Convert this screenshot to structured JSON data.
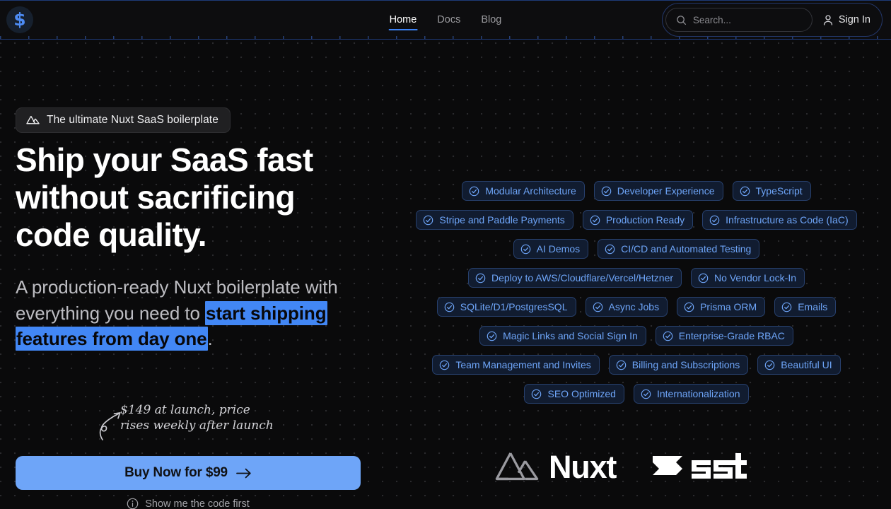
{
  "header": {
    "logo_icon": "dollar-sign-logo",
    "nav": [
      {
        "label": "Home",
        "active": true
      },
      {
        "label": "Docs",
        "active": false
      },
      {
        "label": "Blog",
        "active": false
      }
    ],
    "search": {
      "placeholder": "Search...",
      "value": "",
      "icon": "search-icon"
    },
    "sign_in": {
      "label": "Sign In",
      "icon": "user-icon"
    }
  },
  "hero": {
    "badge": {
      "icon": "nuxt-mountain-icon",
      "label": "The ultimate Nuxt SaaS boilerplate"
    },
    "headline": "Ship your SaaS fast without sacrificing code quality.",
    "subcopy_before": "A production-ready Nuxt boilerplate with everything you need to ",
    "subcopy_highlight": "start shipping features from day one",
    "subcopy_after": ".",
    "note": "$149 at launch, price\nrises weekly after launch",
    "cta": {
      "label": "Buy Now for $99",
      "icon": "arrow-right-icon"
    },
    "secondary": {
      "label": "Show me the code first",
      "icon": "info-icon"
    }
  },
  "features": {
    "check_icon": "check-circle-icon",
    "rows": [
      [
        "Modular Architecture",
        "Developer Experience",
        "TypeScript"
      ],
      [
        "Stripe and Paddle Payments",
        "Production Ready",
        "Infrastructure as Code (IaC)"
      ],
      [
        "AI Demos",
        "CI/CD and Automated Testing"
      ],
      [
        "Deploy to AWS/Cloudflare/Vercel/Hetzner",
        "No Vendor Lock-In"
      ],
      [
        "SQLite/D1/PostgresSQL",
        "Async Jobs",
        "Prisma ORM",
        "Emails"
      ],
      [
        "Magic Links and Social Sign In",
        "Enterprise-Grade RBAC"
      ],
      [
        "Team Management and Invites",
        "Billing and Subscriptions",
        "Beautiful UI"
      ],
      [
        "SEO Optimized",
        "Internationalization"
      ]
    ]
  },
  "brand_logos": [
    {
      "name": "nuxt-logo",
      "label": "Nuxt"
    },
    {
      "name": "sst-logo",
      "label": "sst"
    }
  ],
  "colors": {
    "accent_blue": "#4287f5",
    "cta_blue": "#6ea5f8",
    "pill_text": "#6ea5f8",
    "pill_border": "#27406d",
    "pill_bg": "#111c30",
    "page_bg": "#0a0a0b",
    "header_bg": "#0d0d0f"
  }
}
